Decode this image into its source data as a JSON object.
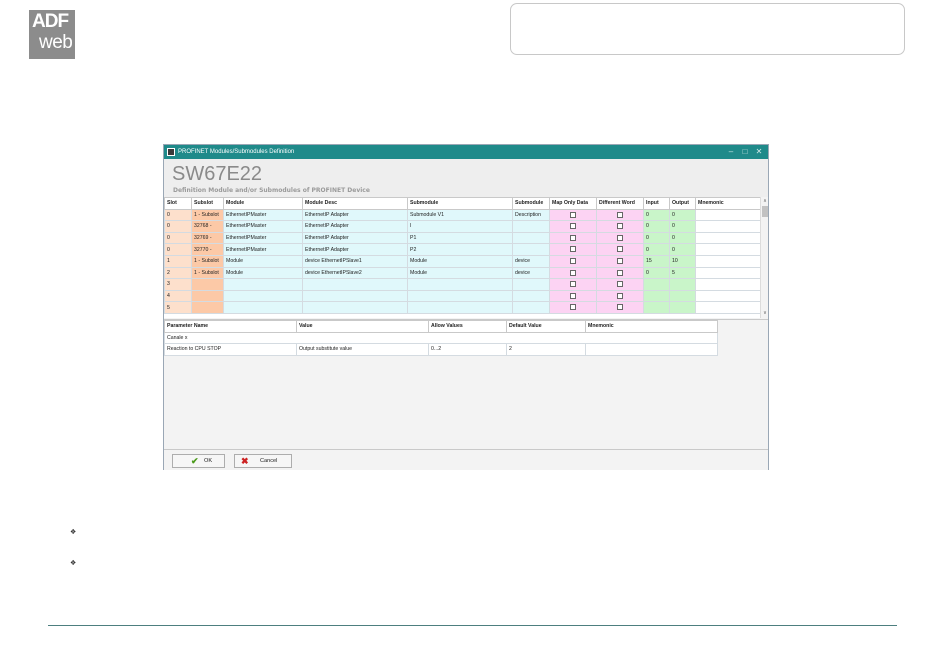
{
  "logo": {
    "line1": "ADF",
    "line2": "web"
  },
  "window": {
    "title": "PROFINET Modules/Submodules Definition",
    "minimize_icon": "–",
    "maximize_icon": "□",
    "close_icon": "✕",
    "heading": "SW67E22",
    "subheading": "Definition Module and/or Submodules of PROFINET Device"
  },
  "modules_grid": {
    "columns": [
      "Slot",
      "Subslot",
      "Module",
      "Module Desc",
      "Submodule",
      "Submodule",
      "Map Only Data",
      "Different Word",
      "Input",
      "Output",
      "Mnemonic"
    ],
    "rows": [
      [
        "0",
        "1 - Subslot",
        "EthernetIPMaster",
        "EthernetIP Adapter",
        "Submodule V1",
        "Description",
        "",
        "",
        "0",
        "0",
        ""
      ],
      [
        "0",
        "32768 -",
        "EthernetIPMaster",
        "EthernetIP Adapter",
        "I",
        "",
        "",
        "",
        "0",
        "0",
        ""
      ],
      [
        "0",
        "32769 -",
        "EthernetIPMaster",
        "EthernetIP Adapter",
        "P1",
        "",
        "",
        "",
        "0",
        "0",
        ""
      ],
      [
        "0",
        "32770 -",
        "EthernetIPMaster",
        "EthernetIP Adapter",
        "P2",
        "",
        "",
        "",
        "0",
        "0",
        ""
      ],
      [
        "1",
        "1 - Subslot",
        "Module",
        "device EthernetIPSlave1",
        "Module",
        "device",
        "",
        "",
        "15",
        "10",
        ""
      ],
      [
        "2",
        "1 - Subslot",
        "Module",
        "device EthernetIPSlave2",
        "Module",
        "device",
        "",
        "",
        "0",
        "5",
        ""
      ],
      [
        "3",
        "",
        "",
        "",
        "",
        "",
        "",
        "",
        "",
        "",
        ""
      ],
      [
        "4",
        "",
        "",
        "",
        "",
        "",
        "",
        "",
        "",
        "",
        ""
      ],
      [
        "5",
        "",
        "",
        "",
        "",
        "",
        "",
        "",
        "",
        "",
        ""
      ]
    ],
    "scroll_up_icon": "∧",
    "scroll_down_icon": "∨"
  },
  "params_grid": {
    "columns": [
      "Parameter Name",
      "Value",
      "Allow Values",
      "Default Value",
      "Mnemonic"
    ],
    "category": "Canale x",
    "rows": [
      [
        "Reaction to CPU STOP",
        "Output substitute value",
        "0...2",
        "2",
        ""
      ]
    ]
  },
  "buttons": {
    "ok_label": "OK",
    "cancel_label": "Cancel",
    "ok_icon": "check-icon",
    "cancel_icon": "cross-icon"
  },
  "bullets": [
    "❖",
    "❖"
  ],
  "colors": {
    "titlebar": "#1f8a8a",
    "slot": "#fde0cc",
    "subslot": "#fcc9a7",
    "module": "#e0f8fb",
    "map_only": "#fcd3f3",
    "input_output": "#c9f5c9",
    "category_row": "#b9d3ec",
    "ok_check": "#4a9a1a",
    "cancel_cross": "#cc2222"
  }
}
